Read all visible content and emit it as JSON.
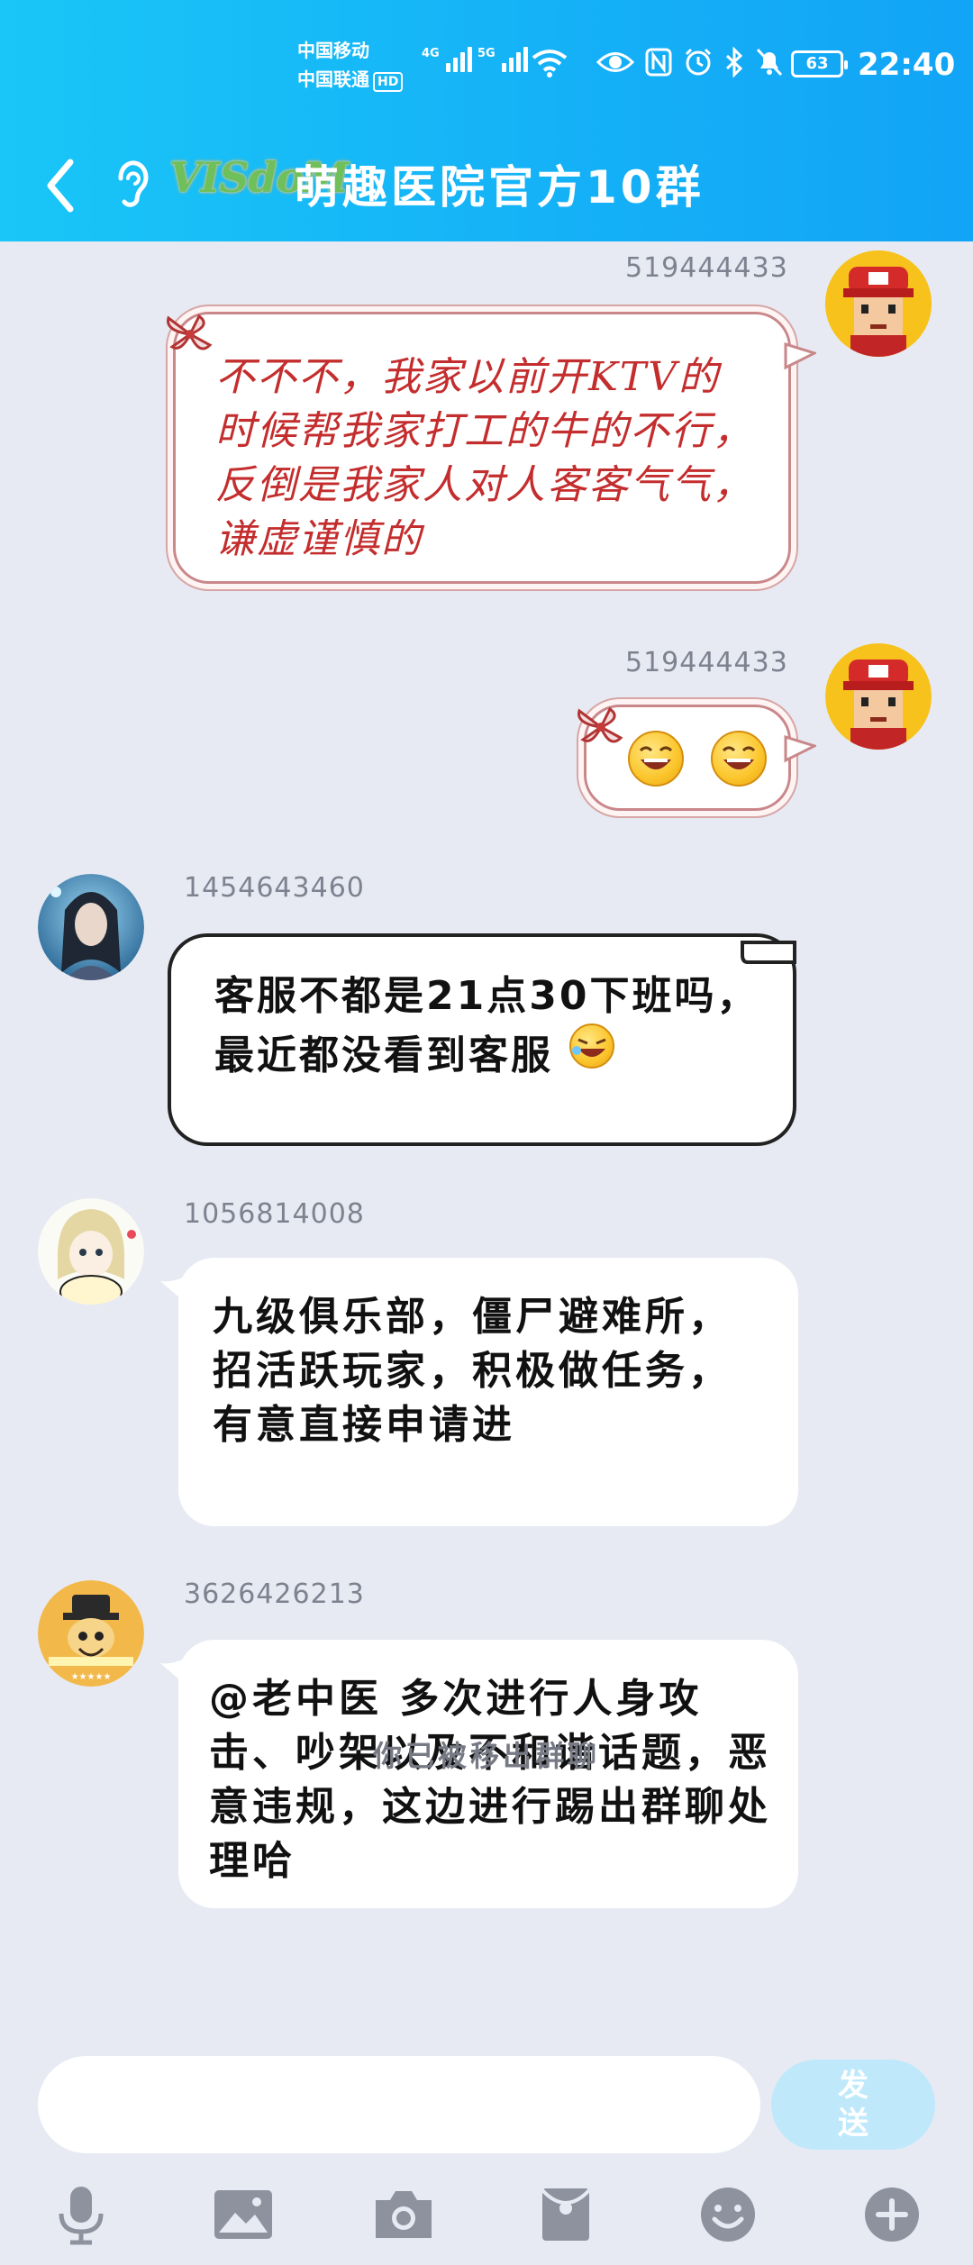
{
  "status_bar": {
    "carrier_1": "中国移动",
    "carrier_2": "中国联通",
    "hd_badge": "HD",
    "network_1": "4G",
    "network_2": "5G",
    "battery": "63",
    "time": "22:40",
    "icons": [
      "wifi-icon",
      "eye-icon",
      "nfc-icon",
      "alarm-icon",
      "bluetooth-icon",
      "mute-icon"
    ]
  },
  "header": {
    "back_icon": "chevron-left-icon",
    "ear_icon": "ear-icon",
    "brand_logo": "VISdoM",
    "title": "萌趣医院官方10群",
    "colors": {
      "gradient_start": "#19c6f7",
      "gradient_end": "#12a4f6"
    }
  },
  "messages": [
    {
      "sender": "519444433",
      "side": "right",
      "style": "fancy",
      "text": "不不不，我家以前开KTV的时候帮我家打工的牛的不行，反倒是我家人对人客客气气，谦虚谨慎的"
    },
    {
      "sender": "519444433",
      "side": "right",
      "style": "fancy",
      "emojis": [
        "grin-emoji",
        "grin-emoji"
      ]
    },
    {
      "sender": "1454643460",
      "side": "left",
      "style": "scroll",
      "text": "客服不都是21点30下班吗，最近都没看到客服",
      "emoji": "laugh-emoji"
    },
    {
      "sender": "1056814008",
      "side": "left",
      "style": "plain",
      "text": "九级俱乐部，僵尸避难所，招活跃玩家，积极做任务，有意直接申请进"
    },
    {
      "sender": "3626426213",
      "side": "left",
      "style": "plain",
      "text": "@老中医 多次进行人身攻击、吵架以及不和谐话题，恶意违规，这边进行踢出群聊处理哈"
    }
  ],
  "system_note": "你已被移出群聊",
  "composer": {
    "placeholder": "",
    "send_label": "发送"
  },
  "toolbar": [
    "microphone-icon",
    "image-icon",
    "camera-icon",
    "red-packet-icon",
    "emoji-icon",
    "plus-icon"
  ]
}
